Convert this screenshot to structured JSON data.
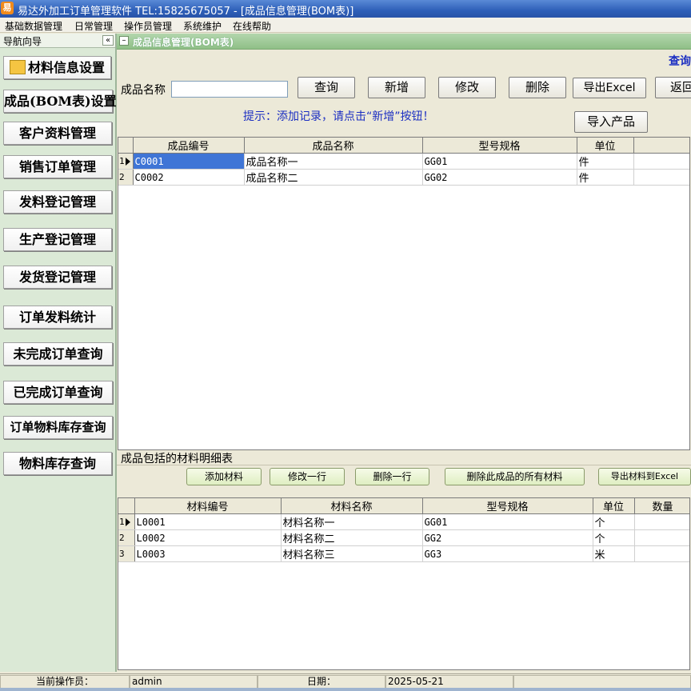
{
  "window": {
    "title": "易达外加工订单管理软件  TEL:15825675057    - [成品信息管理(BOM表)]",
    "icon_label": "易"
  },
  "menu": [
    "基础数据管理",
    "日常管理",
    "操作员管理",
    "系统维护",
    "在线帮助"
  ],
  "nav": {
    "title": "导航向导",
    "collapse_icon": "«",
    "items": [
      "材料信息设置",
      "成品(BOM表)设置",
      "客户资料管理",
      "销售订单管理",
      "发料登记管理",
      "生产登记管理",
      "发货登记管理",
      "订单发料统计",
      "未完成订单查询",
      "已完成订单查询",
      "订单物料库存查询",
      "物料库存查询"
    ]
  },
  "tab": {
    "minimize_icon": "–",
    "title": "成品信息管理(BOM表)"
  },
  "top_link": "查询",
  "form": {
    "name_label": "成品名称",
    "name_value": "",
    "buttons": {
      "query": "查询",
      "add": "新增",
      "edit": "修改",
      "delete": "删除",
      "export": "导出Excel",
      "back": "返回",
      "import": "导入产品"
    },
    "hint": "提示：添加记录，请点击“新增”按钮！"
  },
  "products": {
    "columns": [
      "成品编号",
      "成品名称",
      "型号规格",
      "单位"
    ],
    "rows": [
      {
        "indicator": "1",
        "code": "C0001",
        "name": "成品名称一",
        "spec": "GG01",
        "unit": "件"
      },
      {
        "indicator": "2",
        "code": "C0002",
        "name": "成品名称二",
        "spec": "GG02",
        "unit": "件"
      }
    ]
  },
  "materials_section": {
    "title": "成品包括的材料明细表",
    "buttons": {
      "add": "添加材料",
      "edit": "修改一行",
      "delete": "删除一行",
      "delete_all": "删除此成品的所有材料",
      "export": "导出材料到Excel"
    },
    "columns": [
      "材料编号",
      "材料名称",
      "型号规格",
      "单位",
      "数量"
    ],
    "rows": [
      {
        "indicator": "1",
        "code": "L0001",
        "name": "材料名称一",
        "spec": "GG01",
        "unit": "个",
        "qty": ""
      },
      {
        "indicator": "2",
        "code": "L0002",
        "name": "材料名称二",
        "spec": "GG2",
        "unit": "个",
        "qty": ""
      },
      {
        "indicator": "3",
        "code": "L0003",
        "name": "材料名称三",
        "spec": "GG3",
        "unit": "米",
        "qty": ""
      }
    ]
  },
  "status": {
    "operator_label": "当前操作员：",
    "operator": "admin",
    "date_label": "日期：",
    "date": "2025-05-21"
  },
  "colors": {
    "title_bar": "#2e5fb8",
    "nav_bg": "#dbe9d6",
    "tab_bar": "#8fbf87",
    "selection": "#3f75d6",
    "hint_text": "#1b2ec2"
  }
}
